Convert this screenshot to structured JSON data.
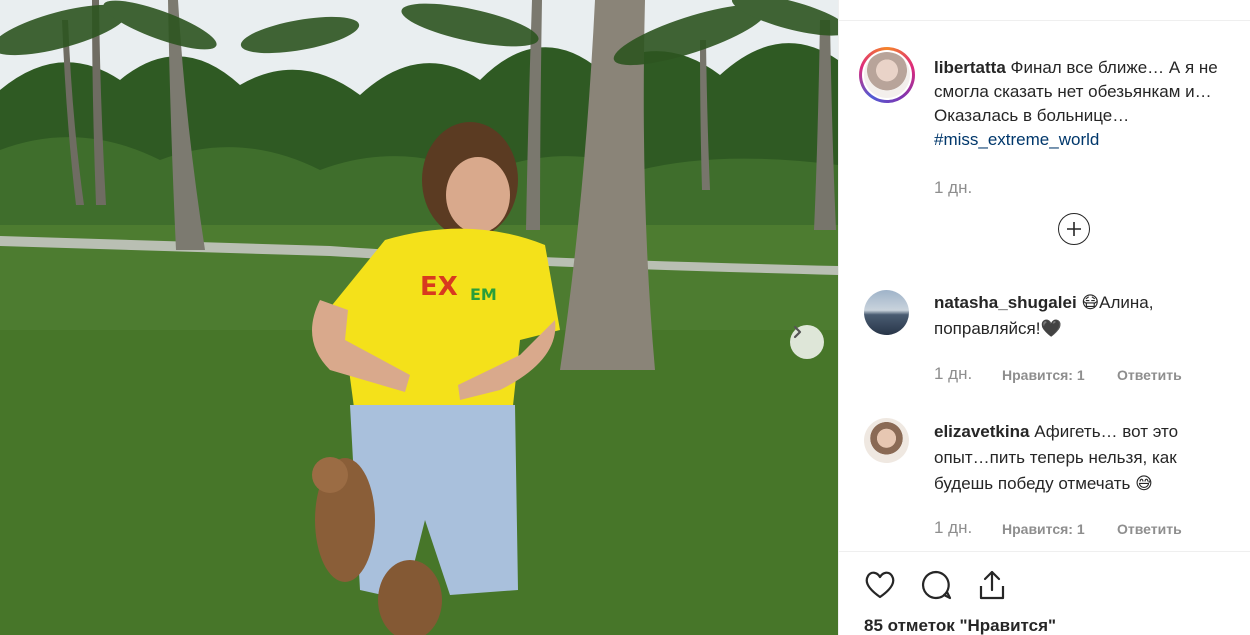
{
  "post": {
    "next_icon": "chevron-right-icon"
  },
  "caption": {
    "username": "libertatta",
    "text_line1": "Финал все ближе… А я не",
    "text_line2": "смогла сказать нет обезьянкам и…",
    "text_line3": "Оказалась в больнице…",
    "hashtag": "#miss_extreme_world",
    "time": "1 дн."
  },
  "load_more_icon": "plus-circle-icon",
  "comments": [
    {
      "username": "natasha_shugalei",
      "text_a": "😷Алина,",
      "text_b": "поправляйся!🖤",
      "time": "1 дн.",
      "likes": "Нравится: 1",
      "reply": "Ответить"
    },
    {
      "username": "elizavetkina",
      "text_a": "Афигеть… вот это",
      "text_b": "опыт…пить теперь нельзя, как",
      "text_c": "будешь победу отмечать 😅",
      "time": "1 дн.",
      "likes": "Нравится: 1",
      "reply": "Ответить"
    }
  ],
  "actions": {
    "like_icon": "heart-icon",
    "comment_icon": "comment-bubble-icon",
    "share_icon": "share-icon"
  },
  "likes_text": "85 отметок \"Нравится\""
}
